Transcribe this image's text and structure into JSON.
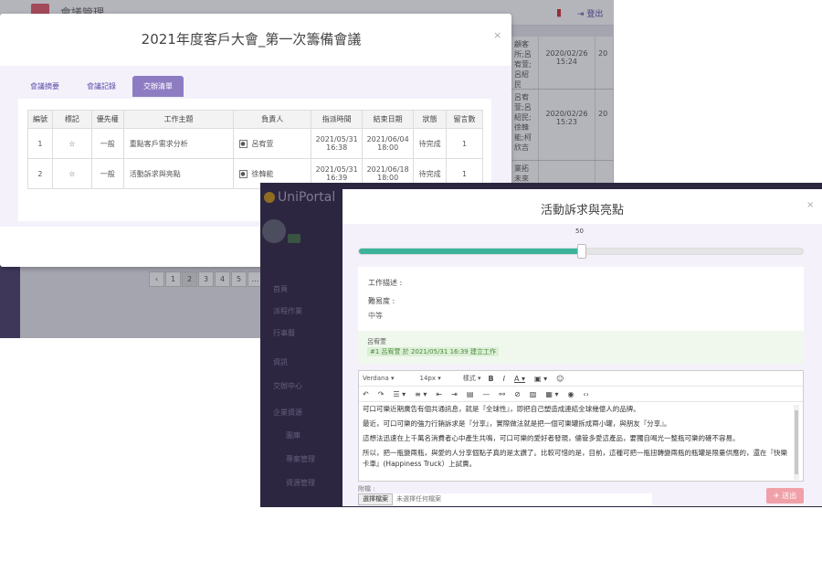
{
  "background": {
    "title": "會議管理",
    "logout": "登出",
    "right_table": [
      {
        "c1": "顧客\n所;呂\n宥萱;\n呂紹民",
        "c2": "2020/02/26\n15:24",
        "c3": "20"
      },
      {
        "c1": "呂宥\n萱;呂\n紹民;\n徐韓\n能;柯\n欣吉",
        "c2": "2020/02/26\n15:23",
        "c3": "20"
      },
      {
        "c1": "業拓\n未來",
        "c2": "",
        "c3": ""
      }
    ],
    "pager": [
      "‹",
      "1",
      "2",
      "3",
      "4",
      "5",
      "…"
    ]
  },
  "modal1": {
    "title": "2021年度客戶大會_第一次籌備會議",
    "close": "×",
    "tabs": [
      {
        "label": "會議摘要",
        "active": false
      },
      {
        "label": "會議記錄",
        "active": false
      },
      {
        "label": "交辦清單",
        "active": true
      }
    ],
    "table": {
      "headers": [
        "編號",
        "標記",
        "優先權",
        "工作主題",
        "負責人",
        "指派時間",
        "結束日期",
        "狀態",
        "留言數"
      ],
      "rows": [
        {
          "no": "1",
          "mark": "☆",
          "priority": "一般",
          "topic": "重點客戶需求分析",
          "owner": "呂宥萱",
          "assigned": "2021/05/31\n16:38",
          "due": "2021/06/04\n18:00",
          "status": "待完成",
          "comments": "1"
        },
        {
          "no": "2",
          "mark": "☆",
          "priority": "一般",
          "topic": "活動訴求與亮點",
          "owner": "徐韓能",
          "assigned": "2021/05/31\n16:39",
          "due": "2021/06/18\n18:00",
          "status": "待完成",
          "comments": "1"
        }
      ]
    }
  },
  "bg2": {
    "brand": "UniPortal",
    "nav": [
      "首頁",
      "派程作業",
      "行事曆",
      "資訊",
      "交辦中心",
      "企業資源",
      "圖庫",
      "專案管理",
      "資源管理"
    ]
  },
  "modal2": {
    "title": "活動訴求與亮點",
    "close": "×",
    "progress": 50,
    "progress_label": "50",
    "work_desc_label": "工作描述 :",
    "difficulty_label": "難易度 :",
    "difficulty_value": "中等",
    "log_user": "呂宥萱",
    "log_message": "#1 呂宥萱 於 2021/05/31 16:39 建立工作",
    "toolbar": {
      "font": "Verdana",
      "size": "14px",
      "style": "樣式"
    },
    "content": [
      "可口可樂近期廣告有個共通訊息，就是『全球性』，即把自己塑造成連結全球幾億人的品牌。",
      "最近，可口可樂的強力行銷訴求是『分享』，實際做法就是把一個可樂罐拆成兩小罐，與朋友『分享』。",
      "這想法迅速在上千萬名消費者心中產生共鳴，可口可樂的愛好者發現，儘管多愛這產品，要獨自喝光一整瓶可樂的確不容易。",
      "所以，把一瓶變兩瓶，與愛的人分享個點子真的是太讚了。比較可惜的是，目前，這種可把一瓶扭轉變兩瓶的瓶罐是限量供應的，還在『快樂卡車』(Happiness Truck）上試賣。"
    ],
    "attach_label": "附檔 :",
    "attach_button": "選擇檔案",
    "attach_none": "未選擇任何檔案",
    "send_button": "✈ 送出",
    "colors": {
      "accent": "#8e7cc3",
      "progress": "#3bb49a",
      "send": "#f0a0a8"
    }
  }
}
